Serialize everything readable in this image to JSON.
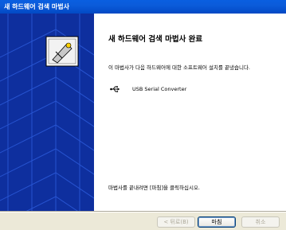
{
  "window": {
    "title": "새 하드웨어 검색 마법사"
  },
  "main": {
    "heading": "새 하드웨어 검색 마법사 완료",
    "description": "이 마법사가 다음 하드웨어에 대한 소프트웨어 설치를 끝냈습니다.",
    "device": {
      "icon": "usb-icon",
      "name": "USB Serial Converter"
    },
    "finish_note": "마법사를 끝내려면 [마침]을 클릭하십시오."
  },
  "buttons": {
    "back_label": "< 뒤로(B)",
    "finish_label": "마침",
    "cancel_label": "취소"
  },
  "colors": {
    "titlebar": "#0A5FE0",
    "side_panel": "#0E2F9E",
    "dialog_bg": "#ECE9D8"
  }
}
